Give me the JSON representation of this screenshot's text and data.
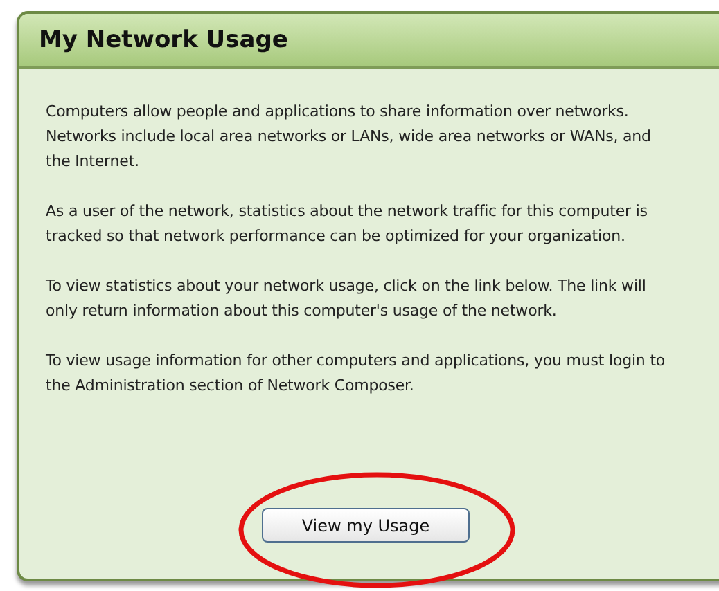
{
  "panel": {
    "title": "My Network Usage",
    "paragraphs": [
      "Computers allow people and applications to share information over networks. Networks include local area networks or LANs, wide area networks or WANs, and the Internet.",
      "As a user of the network, statistics about the network traffic for this computer is tracked so that network performance can be optimized for your organization.",
      "To view statistics about your network usage, click on the link below. The link will only return information about this computer's usage of the network.",
      "To view usage information for other computers and applications, you must login to the Administration section of Network Composer."
    ],
    "button": "View my Usage"
  }
}
